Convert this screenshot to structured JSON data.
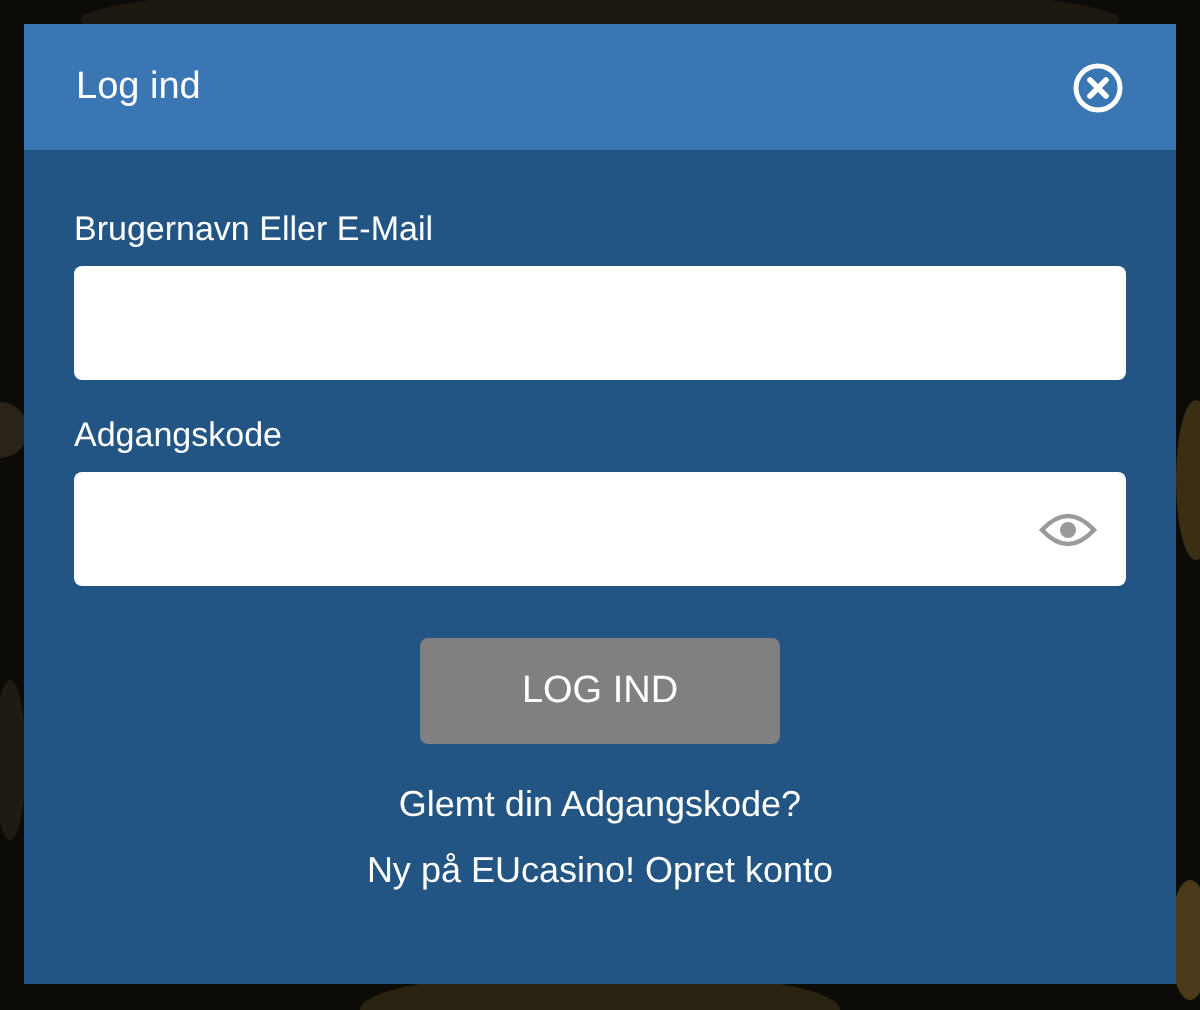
{
  "dialog": {
    "title": "Log ind"
  },
  "fields": [
    {
      "label": "Brugernavn Eller E-Mail",
      "kind": "text"
    },
    {
      "label": "Adgangskode",
      "kind": "password"
    }
  ],
  "submit_button": {
    "label": "LOG IND",
    "disabled": true
  },
  "forgot_link": "Glemt din Adgangskode?",
  "signup": {
    "prompt": "Ny på EUcasino!",
    "link": "Opret konto"
  }
}
